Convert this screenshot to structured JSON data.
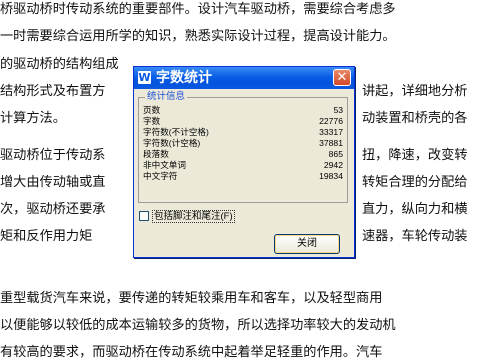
{
  "document": {
    "lines": [
      "桥驱动桥时传动系统的重要部件。设计汽车驱动桥，需要综合考虑多",
      "一时需要综合运用所学的知识，熟悉实际设计过程，提高设计能力。",
      "的驱动桥的结构组成",
      "结构形式及布置方",
      "计算方法。",
      "驱动桥位于传动系",
      "增大由传动轴或直",
      "次，驱动桥还要承",
      "矩和反作用力矩",
      "重型载货汽车来说，要传递的转矩较乘用车和客车，以及轻型商用",
      "以便能够以较低的成本运输较多的货物，所以选择功率较大的发动机",
      "有较高的要求，而驱动桥在传动系统中起着举足轻重的作用。汽车"
    ],
    "right_fragments": [
      "讲起，详细地分析",
      "动装置和桥壳的各",
      "扭，降速，改变转",
      "转矩合理的分配给",
      "直力，纵向力和横",
      "速器，车轮传动装"
    ]
  },
  "dialog": {
    "title": "字数统计",
    "title_icon": "W",
    "close_icon": "close-icon",
    "group_label": "统计信息",
    "stats": [
      {
        "label": "页数",
        "value": "53"
      },
      {
        "label": "字数",
        "value": "22776"
      },
      {
        "label": "字符数(不计空格)",
        "value": "33317"
      },
      {
        "label": "字符数(计空格)",
        "value": "37881"
      },
      {
        "label": "段落数",
        "value": "865"
      },
      {
        "label": "非中文单词",
        "value": "2942"
      },
      {
        "label": "中文字符",
        "value": "19834"
      }
    ],
    "checkbox_label": "包括脚注和尾注(F)",
    "checkbox_checked": false,
    "close_button_label": "关闭",
    "colors": {
      "title_bar": "#0a58e2",
      "close_button": "#d2492a",
      "group_label": "#1c4fd8"
    }
  }
}
